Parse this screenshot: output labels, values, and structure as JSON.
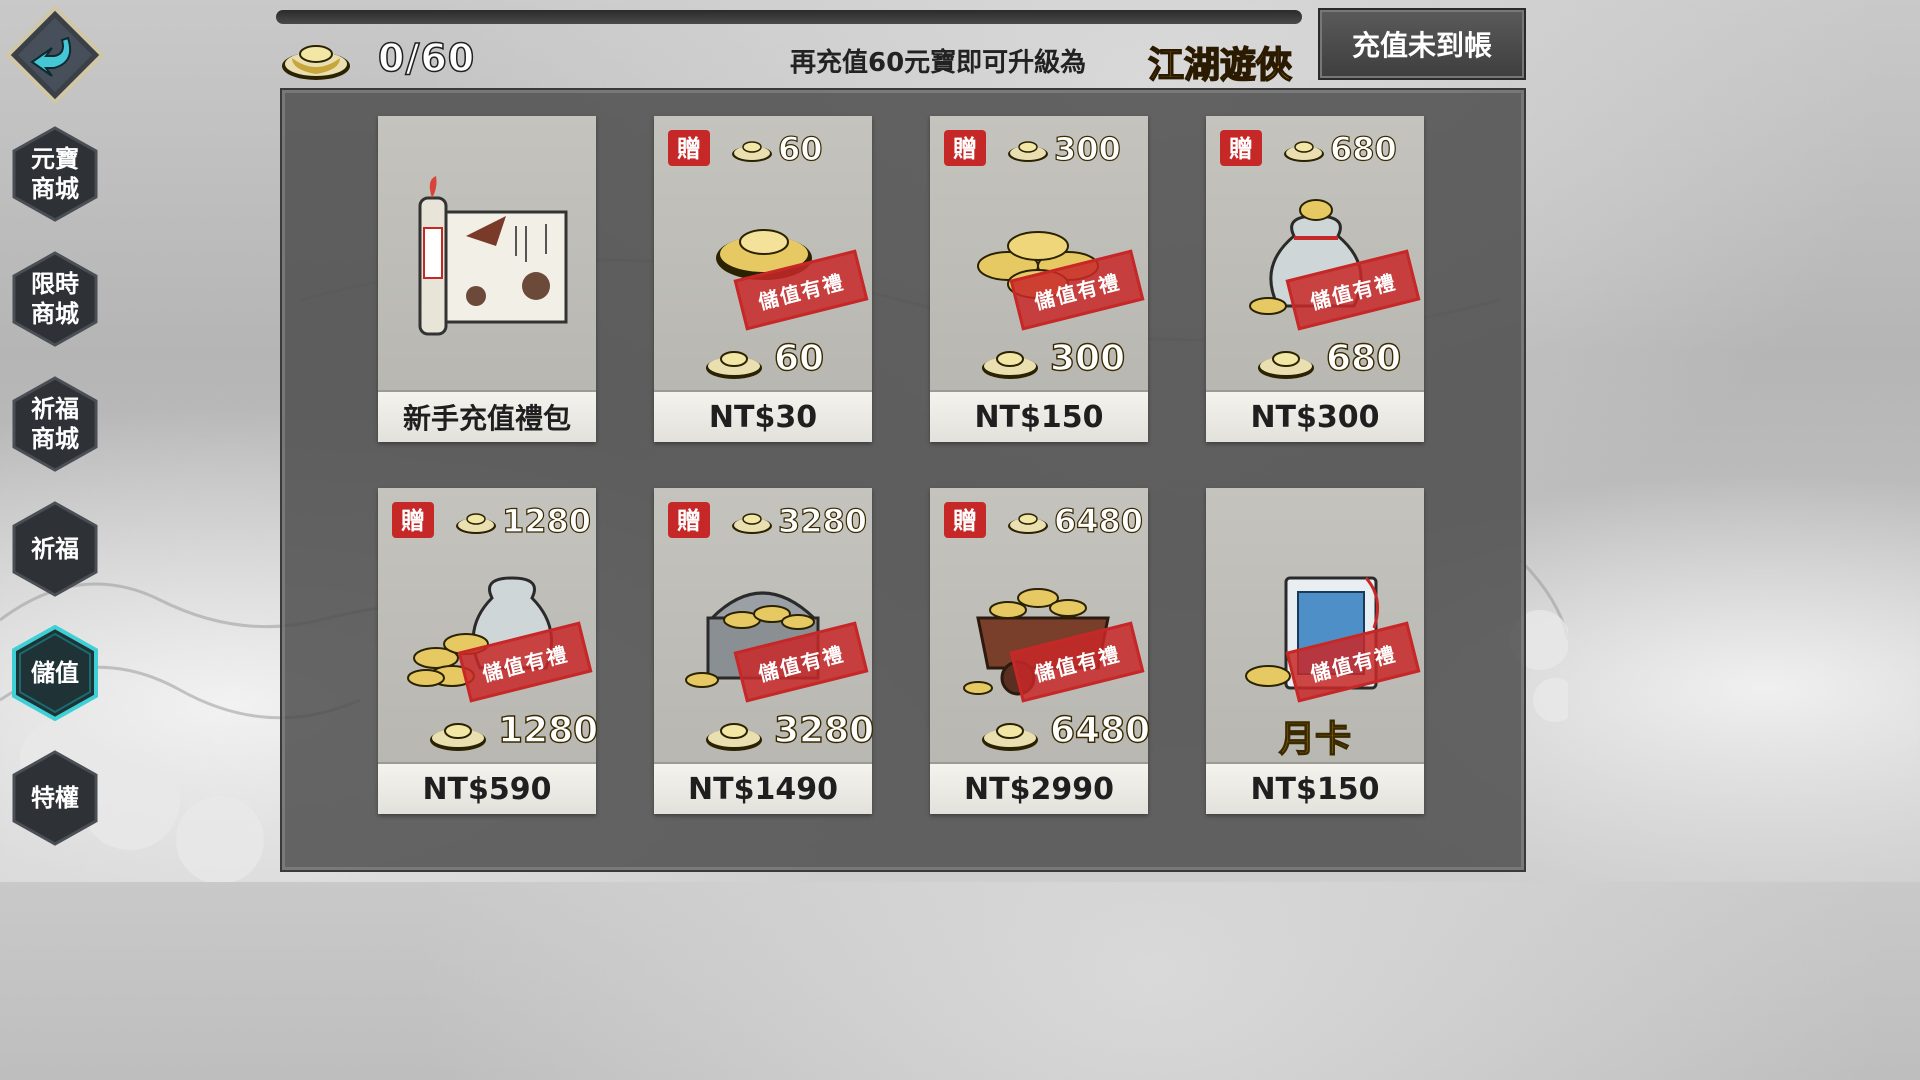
{
  "header": {
    "balance": "0/60",
    "upgrade_text": "再充值60元寶即可升級為",
    "next_rank": "江湖遊俠",
    "unreceived_button": "充值未到帳"
  },
  "sidebar": {
    "items": [
      {
        "label": "元寶\n商城",
        "active": false
      },
      {
        "label": "限時\n商城",
        "active": false
      },
      {
        "label": "祈福\n商城",
        "active": false
      },
      {
        "label": "祈福",
        "active": false
      },
      {
        "label": "儲值",
        "active": true
      },
      {
        "label": "特權",
        "active": false
      }
    ]
  },
  "gift_char": "贈",
  "stamp_text": "儲值有禮",
  "cards": [
    {
      "title": "新手充值禮包",
      "price": "新手充值禮包"
    },
    {
      "bonus": "60",
      "base": "60",
      "price": "NT$30"
    },
    {
      "bonus": "300",
      "base": "300",
      "price": "NT$150"
    },
    {
      "bonus": "680",
      "base": "680",
      "price": "NT$300"
    },
    {
      "bonus": "1280",
      "base": "1280",
      "price": "NT$590"
    },
    {
      "bonus": "3280",
      "base": "3280",
      "price": "NT$1490"
    },
    {
      "bonus": "6480",
      "base": "6480",
      "price": "NT$2990"
    },
    {
      "month_label": "月卡",
      "price": "NT$150"
    }
  ],
  "colors": {
    "accent_gold": "#f5a623",
    "stamp_red": "#c62828",
    "active_nav_glow": "#3fd0d6"
  }
}
